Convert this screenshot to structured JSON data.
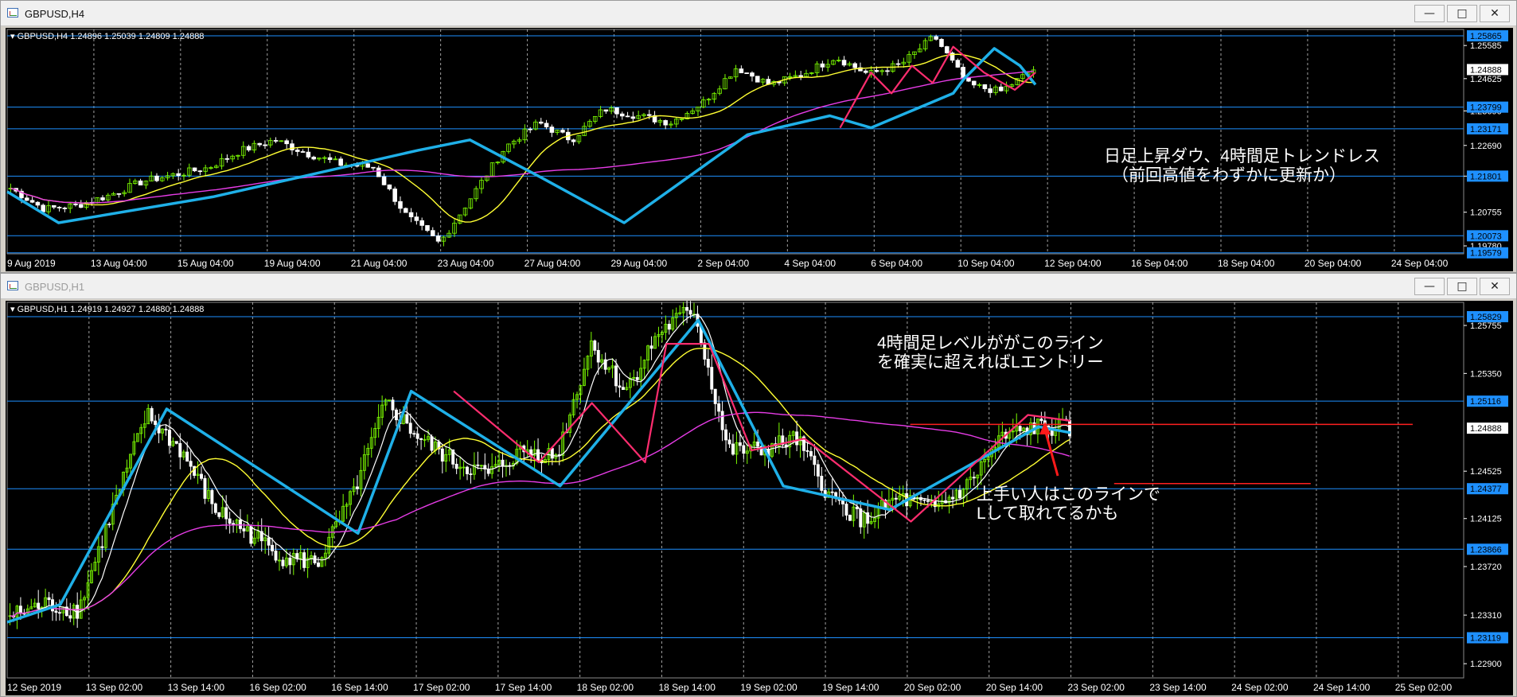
{
  "windows": [
    {
      "title": "GBPUSD,H4",
      "active": true,
      "info": "GBPUSD,H4  1.24896 1.25039 1.24809 1.24888",
      "price_axis": {
        "levels": [
          "1.25585",
          "1.24625",
          "1.23690",
          "1.22690",
          "1.21801",
          "1.20755",
          "1.19780"
        ],
        "markers": [
          {
            "value": "1.25865",
            "style": "blue"
          },
          {
            "value": "1.24888",
            "style": "white"
          },
          {
            "value": "1.23799",
            "style": "blue"
          },
          {
            "value": "1.23171",
            "style": "blue"
          },
          {
            "value": "1.21801",
            "style": "blue"
          },
          {
            "value": "1.20073",
            "style": "blue"
          },
          {
            "value": "1.19579",
            "style": "blue"
          }
        ]
      },
      "time_axis": [
        "9 Aug 2019",
        "13 Aug 04:00",
        "15 Aug 04:00",
        "19 Aug 04:00",
        "21 Aug 04:00",
        "23 Aug 04:00",
        "27 Aug 04:00",
        "29 Aug 04:00",
        "2 Sep 04:00",
        "4 Sep 04:00",
        "6 Sep 04:00",
        "10 Sep 04:00",
        "12 Sep 04:00",
        "16 Sep 04:00",
        "18 Sep 04:00",
        "20 Sep 04:00",
        "24 Sep 04:00"
      ],
      "annotations": [
        {
          "lines": [
            "日足上昇ダウ、4時間足トレンドレス",
            "（前回高値をわずかに更新か）"
          ]
        }
      ]
    },
    {
      "title": "GBPUSD,H1",
      "active": false,
      "info": "GBPUSD,H1  1.24919 1.24927 1.24880 1.24888",
      "price_axis": {
        "levels": [
          "1.25755",
          "1.25350",
          "1.24525",
          "1.24125",
          "1.23720",
          "1.23310",
          "1.22900"
        ],
        "markers": [
          {
            "value": "1.25829",
            "style": "blue"
          },
          {
            "value": "1.25116",
            "style": "blue"
          },
          {
            "value": "1.24888",
            "style": "white"
          },
          {
            "value": "1.24377",
            "style": "blue"
          },
          {
            "value": "1.23866",
            "style": "blue"
          },
          {
            "value": "1.23119",
            "style": "blue"
          }
        ]
      },
      "time_axis": [
        "12 Sep 2019",
        "13 Sep 02:00",
        "13 Sep 14:00",
        "16 Sep 02:00",
        "16 Sep 14:00",
        "17 Sep 02:00",
        "17 Sep 14:00",
        "18 Sep 02:00",
        "18 Sep 14:00",
        "19 Sep 02:00",
        "19 Sep 14:00",
        "20 Sep 02:00",
        "20 Sep 14:00",
        "23 Sep 02:00",
        "23 Sep 14:00",
        "24 Sep 02:00",
        "24 Sep 14:00",
        "25 Sep 02:00"
      ],
      "annotations": [
        {
          "lines": [
            "4時間足レベルががこのライン",
            "を確実に超えればLエントリー"
          ]
        },
        {
          "lines": [
            "上手い人はこのラインで",
            "Lして取れてるかも"
          ]
        }
      ]
    }
  ],
  "colors": {
    "background": "#000000",
    "up": "#7CFC00",
    "down": "#FFFFFF",
    "zigzag": "#1fb0e8",
    "zigzag2": "#ff2d6f",
    "ma_fast": "#ffffff",
    "ma_mid": "#ffff33",
    "ma_slow": "#e63ce6",
    "level": "#1e90ff",
    "hline": "#ff2020"
  },
  "chart_data": [
    {
      "type": "candlestick",
      "symbol": "GBPUSD",
      "timeframe": "H4",
      "ylim": [
        1.1955,
        1.2605
      ],
      "x": [
        "9 Aug 2019",
        "13 Aug 04:00",
        "15 Aug 04:00",
        "19 Aug 04:00",
        "21 Aug 04:00",
        "23 Aug 04:00",
        "27 Aug 04:00",
        "29 Aug 04:00",
        "2 Sep 04:00",
        "4 Sep 04:00",
        "6 Sep 04:00",
        "10 Sep 04:00",
        "12 Sep 04:00",
        "16 Sep 04:00",
        "18 Sep 04:00",
        "20 Sep 04:00",
        "24 Sep 04:00"
      ],
      "close_path": [
        1.2145,
        1.2085,
        1.2095,
        1.2125,
        1.2165,
        1.2185,
        1.2205,
        1.2255,
        1.2285,
        1.2245,
        1.2215,
        1.2205,
        1.2065,
        1.1985,
        1.2125,
        1.2265,
        1.2335,
        1.2285,
        1.2375,
        1.2355,
        1.2335,
        1.2395,
        1.2495,
        1.2445,
        1.2475,
        1.2525,
        1.2475,
        1.2505,
        1.2585,
        1.2445,
        1.2425,
        1.2489
      ],
      "horizontal_levels": [
        1.25865,
        1.23799,
        1.23171,
        1.21801,
        1.20073,
        1.19579
      ]
    },
    {
      "type": "candlestick",
      "symbol": "GBPUSD",
      "timeframe": "H1",
      "ylim": [
        1.2278,
        1.2595
      ],
      "x": [
        "12 Sep 2019",
        "13 Sep 02:00",
        "13 Sep 14:00",
        "16 Sep 02:00",
        "16 Sep 14:00",
        "17 Sep 02:00",
        "17 Sep 14:00",
        "18 Sep 02:00",
        "18 Sep 14:00",
        "19 Sep 02:00",
        "19 Sep 14:00",
        "20 Sep 02:00",
        "20 Sep 14:00",
        "23 Sep 02:00",
        "23 Sep 14:00",
        "24 Sep 02:00",
        "24 Sep 14:00",
        "25 Sep 02:00"
      ],
      "close_path": [
        1.233,
        1.234,
        1.2335,
        1.242,
        1.25,
        1.247,
        1.242,
        1.24,
        1.238,
        1.2375,
        1.243,
        1.251,
        1.248,
        1.246,
        1.245,
        1.247,
        1.2465,
        1.256,
        1.252,
        1.257,
        1.259,
        1.247,
        1.247,
        1.248,
        1.243,
        1.241,
        1.243,
        1.242,
        1.244,
        1.248,
        1.249,
        1.2488
      ],
      "horizontal_levels": [
        1.25829,
        1.25116,
        1.24377,
        1.23866,
        1.23119
      ],
      "red_lines": [
        1.2492,
        1.2442
      ]
    }
  ]
}
